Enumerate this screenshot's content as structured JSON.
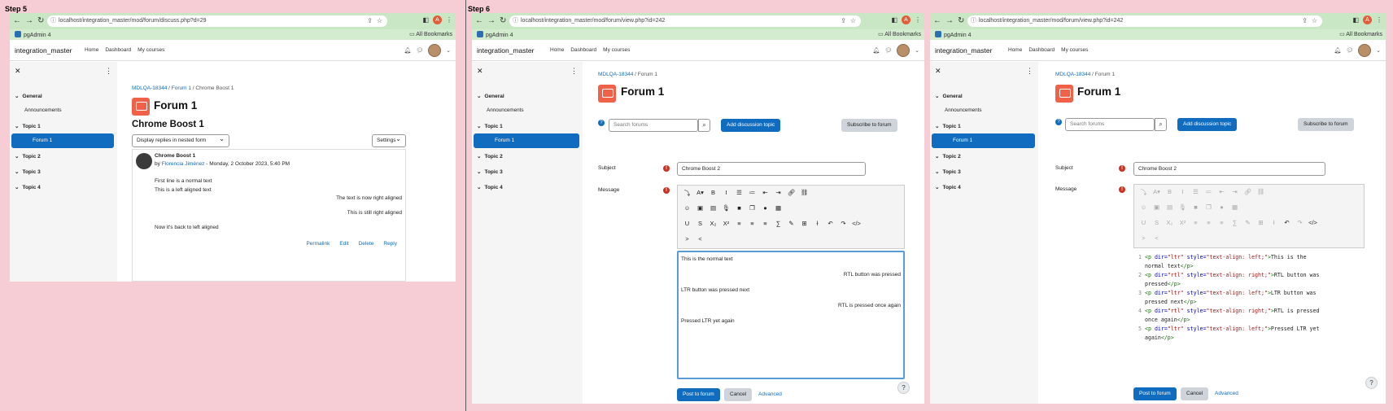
{
  "steps": [
    "Step 5",
    "Step 6"
  ],
  "browser": {
    "url1": "localhost/integration_master/mod/forum/discuss.php?d=29",
    "url2": "localhost/integration_master/mod/forum/view.php?id=242",
    "bookmark": "pgAdmin 4",
    "all_bookmarks": "All Bookmarks",
    "profile_letter": "A"
  },
  "header": {
    "brand": "integration_master",
    "nav": [
      "Home",
      "Dashboard",
      "My courses"
    ]
  },
  "drawer": {
    "sections": [
      "General",
      "Topic 1",
      "Topic 2",
      "Topic 3",
      "Topic 4"
    ],
    "announcements": "Announcements",
    "active": "Forum 1"
  },
  "discuss": {
    "crumbs": [
      "MDLQA-18344",
      "Forum 1",
      "Chrome Boost 1"
    ],
    "forum_title": "Forum 1",
    "discussion_title": "Chrome Boost 1",
    "display_mode": "Display replies in nested form",
    "settings": "Settings",
    "post": {
      "subject": "Chrome Boost 1",
      "by": "by",
      "author": "Florencia Jiménez",
      "date": " - Monday, 2 October 2023, 5:40 PM",
      "lines": [
        "First line is a normal text",
        "This is a left aligned text",
        "The text is now right aligned",
        "This is still right aligned",
        "Now it's back to left aligned"
      ],
      "actions": [
        "Permalink",
        "Edit",
        "Delete",
        "Reply"
      ]
    }
  },
  "compose": {
    "crumbs": [
      "MDLQA-18344",
      "Forum 1"
    ],
    "forum_title": "Forum 1",
    "search_placeholder": "Search forums",
    "add_topic": "Add discussion topic",
    "subscribe": "Subscribe to forum",
    "subject_label": "Subject",
    "message_label": "Message",
    "subject_value": "Chrome Boost 2",
    "editor_lines": [
      "This is the normal text",
      "RTL button was pressed",
      "LTR button was pressed next",
      "RTL is pressed once again",
      "Pressed LTR yet again"
    ],
    "post_btn": "Post to forum",
    "cancel_btn": "Cancel",
    "advanced": "Advanced",
    "help": "?"
  },
  "code": [
    {
      "n": "1",
      "dir": "\"ltr\"",
      "style": "\"text-align: left;\"",
      "t1": "This is the",
      "t2": "normal text"
    },
    {
      "n": "2",
      "dir": "\"rtl\"",
      "style": "\"text-align: right;\"",
      "t1": "RTL button was",
      "t2": "pressed"
    },
    {
      "n": "3",
      "dir": "\"ltr\"",
      "style": "\"text-align: left;\"",
      "t1": "LTR button was",
      "t2": "pressed next"
    },
    {
      "n": "4",
      "dir": "\"rtl\"",
      "style": "\"text-align: right;\"",
      "t1": "RTL is pressed",
      "t2": "once again"
    },
    {
      "n": "5",
      "dir": "\"ltr\"",
      "style": "\"text-align: left;\"",
      "t1": "Pressed LTR yet",
      "t2": "again"
    }
  ]
}
